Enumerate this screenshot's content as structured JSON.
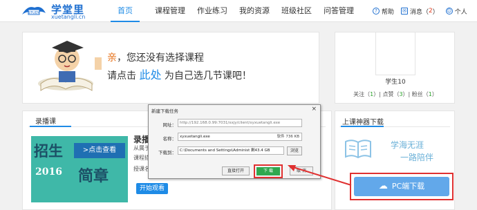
{
  "header": {
    "logo_name": "学堂里",
    "logo_sub": "xuetangli.cn",
    "logo_badge": "STUDY",
    "nav": [
      "首页",
      "课程管理",
      "作业练习",
      "我的资源",
      "班级社区",
      "问答管理"
    ],
    "help_label": "帮助",
    "msg_label": "消息",
    "msg_count": "2",
    "personal_label": "个人"
  },
  "prompt": {
    "qin": "亲",
    "line1_rest": "，您还没有选择课程",
    "line2_pre": "请点击",
    "here": "此处",
    "line2_post": "为自己选几节课吧！"
  },
  "profile": {
    "name": "学生10",
    "follow_label": "关注",
    "follow_count": "1",
    "likes_label": "点赞",
    "likes_count": "3",
    "fans_label": "粉丝",
    "fans_count": "1"
  },
  "recorded": {
    "section_title": "录播课",
    "banner_text1": "招生",
    "banner_cta": ">点击查看",
    "banner_year": "2016",
    "banner_text2": "简章",
    "course_title": "录播",
    "line1": "从属于",
    "line2": "课程描",
    "line3": "授课名",
    "watch_label": "开始观看"
  },
  "sidebar": {
    "title": "上课神器下载",
    "slogan1": "学海无涯",
    "slogan2": "一路陪伴",
    "pc_download": "PC端下载"
  },
  "dialog": {
    "title": "新建下载任务",
    "url_label": "网址：",
    "url_value": "http://192.168.0.99:7031/xxjy/client/xyxuetangli.exe",
    "name_label": "名称：",
    "name_value": "xyxuetangli.exe",
    "name_size": "软件 736 KB",
    "path_label": "下载到：",
    "path_value": "C:\\Documents and Settings\\Administ 剩43.4 GB",
    "browse_label": "浏览",
    "open_label": "直接打开",
    "download_label": "下 载",
    "cancel_label": "取 消"
  },
  "colors": {
    "accent": "#1e8be6",
    "highlight": "#e03030",
    "download_green": "#2fa84f",
    "pc_button": "#62a8ea"
  }
}
